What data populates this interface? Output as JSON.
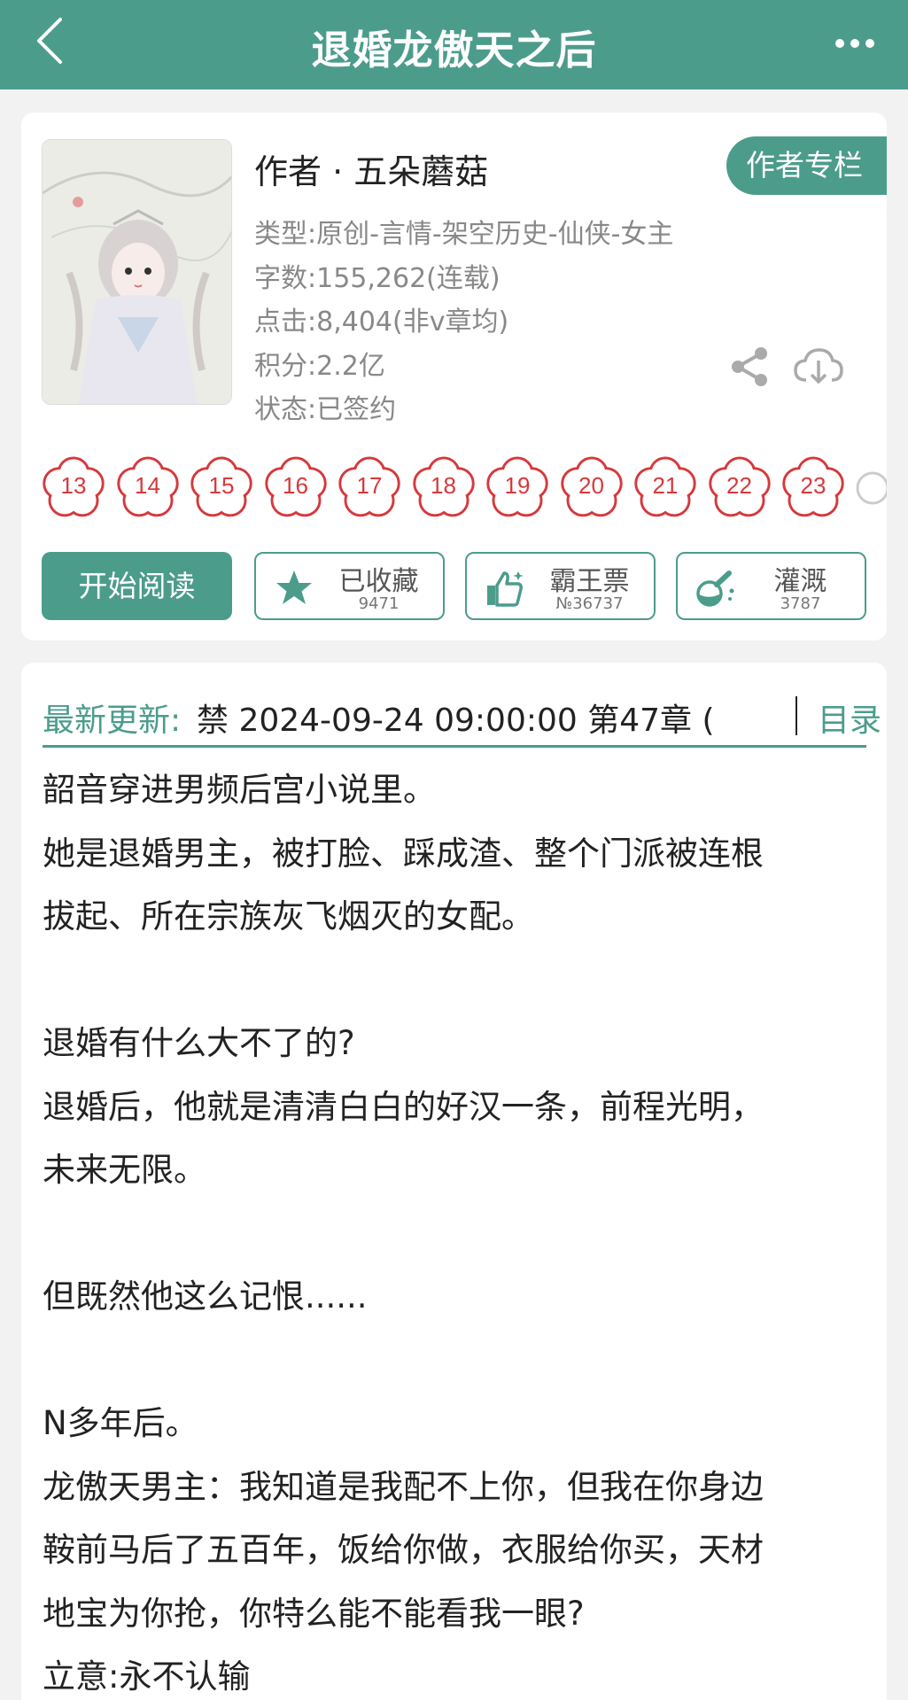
{
  "header": {
    "title": "退婚龙傲天之后",
    "back_icon": "chevron-left-icon",
    "more_icon": "more-dots-icon"
  },
  "book": {
    "author": "作者 · 五朵蘑菇",
    "author_column_label": "作者专栏",
    "genre": "类型:原创-言情-架空历史-仙侠-女主",
    "word_count": "字数:155,262(连载)",
    "clicks": "点击:8,404(非v章均)",
    "score": "积分:2.2亿",
    "status": "状态:已签约"
  },
  "badges": [
    "13",
    "14",
    "15",
    "16",
    "17",
    "18",
    "19",
    "20",
    "21",
    "22",
    "23"
  ],
  "actions": {
    "read_label": "开始阅读",
    "collect_label": "已收藏",
    "collect_count": "9471",
    "vote_label": "霸王票",
    "vote_count": "№36737",
    "water_label": "灌溉",
    "water_count": "3787"
  },
  "latest": {
    "label": "最新更新:",
    "info": "禁 2024-09-24 09:00:00  第47章 (",
    "toc_label": "目录"
  },
  "intro": [
    "韶音穿进男频后宫小说里。",
    "她是退婚男主，被打脸、踩成渣、整个门派被连根",
    "拔起、所在宗族灰飞烟灭的女配。",
    "",
    "退婚有什么大不了的?",
    "退婚后，他就是清清白白的好汉一条，前程光明，",
    "未来无限。",
    "",
    "但既然他这么记恨......",
    "",
    "N多年后。",
    "龙傲天男主：我知道是我配不上你，但我在你身边",
    "鞍前马后了五百年，饭给你做，衣服给你买，天材",
    "地宝为你抢，你特么能不能看我一眼?",
    "立意:永不认输"
  ],
  "colors": {
    "brand": "#4c9c8c",
    "badge_red": "#d6393c"
  }
}
